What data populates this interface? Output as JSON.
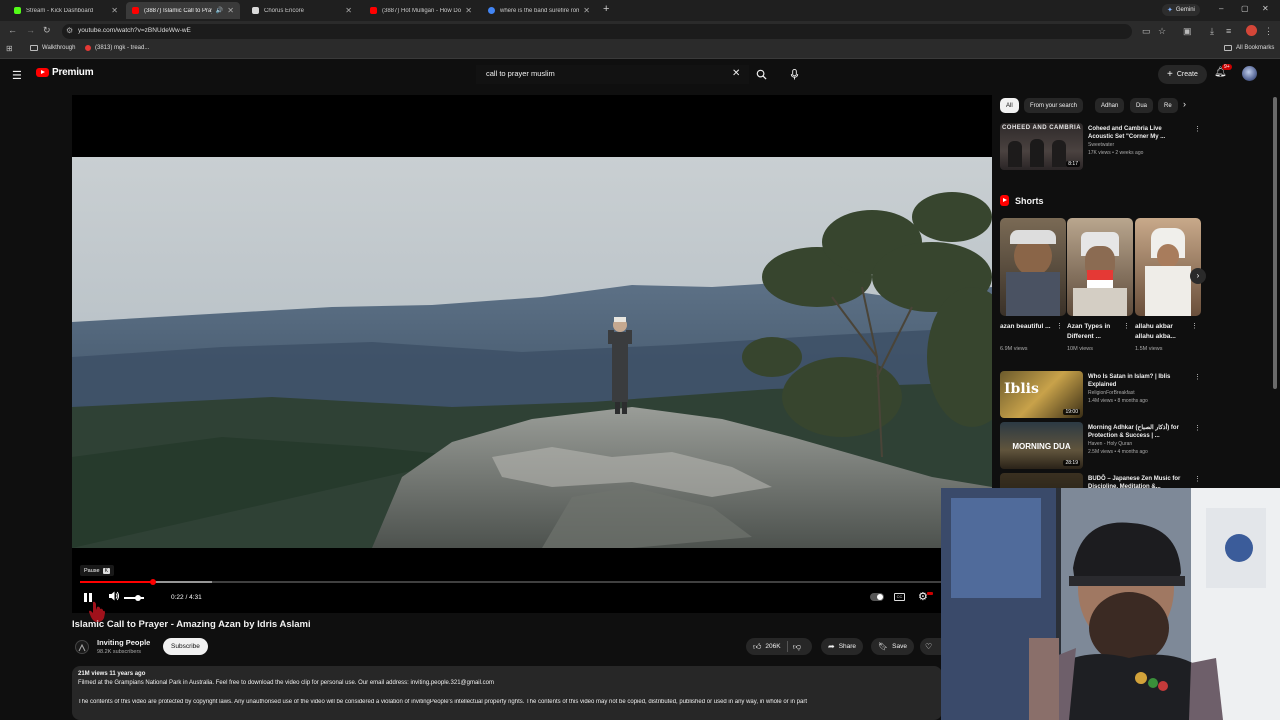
{
  "browser": {
    "tabs": [
      {
        "title": "Stream - Kick Dashboard",
        "color": "#53fc18"
      },
      {
        "title": "(3887) Islamic Call to Prayer",
        "color": "#ff0000"
      },
      {
        "title": "Chorus Encore",
        "color": "#d9d9d9"
      },
      {
        "title": "(3887) Hot Mulligan - How Do",
        "color": "#ff0000"
      },
      {
        "title": "where is the band surefire rom",
        "color": "#4285f4"
      }
    ],
    "gemini_label": "Gemini",
    "url": "youtube.com/watch?v=zBNUdeWw-wE",
    "bookmarks": [
      {
        "label": "Walkthrough"
      },
      {
        "label": "(3813) mgk - tread..."
      }
    ],
    "all_bookmarks": "All Bookmarks"
  },
  "header": {
    "logo_text": "Premium",
    "search_query": "call to prayer muslim",
    "create_label": "Create",
    "notif_badge": "9+"
  },
  "player": {
    "tooltip": "Pause",
    "tooltip_key": "K",
    "time_display": "0:22 / 4:31",
    "progress_played_fraction": 0.081,
    "progress_loaded_fraction": 0.146,
    "volume_fraction": 0.7
  },
  "video": {
    "title": "Islamic Call to Prayer - Amazing Azan by Idris Aslami",
    "channel": "Inviting People",
    "subscribers": "98.2K subscribers",
    "subscribe_label": "Subscribe",
    "likes": "206K",
    "share_label": "Share",
    "save_label": "Save",
    "views_date": "21M views  11 years ago",
    "desc_line1": "Filmed at the Grampians National Park in Australia. Feel free to download the video clip for personal use. Our email address: inviting.people.321@gmail.com",
    "desc_line2": "The contents of this video are protected by copyright laws.  Any unauthorised use of the video will be considered a violation of invitingPeople's intellectual property rights. The contents of this video may not be copied, distributed, published or used in any way, in whole or in part"
  },
  "sidebar": {
    "chips": [
      "All",
      "From your search",
      "Adhan",
      "Dua",
      "Re"
    ],
    "rec_top": {
      "title": "Coheed and Cambria Live Acoustic Set \"Corner My ...",
      "channel": "Sweetwater",
      "meta": "17K views • 2 weeks ago",
      "duration": "8:17",
      "thumb_text": "COHEED AND CAMBRIA"
    },
    "shorts_label": "Shorts",
    "shorts": [
      {
        "title": "azan beautiful ...",
        "views": "6.9M views"
      },
      {
        "title": "Azan Types in Different ...",
        "views": "10M views"
      },
      {
        "title": "allahu akbar allahu akba...",
        "views": "1.5M views"
      }
    ],
    "recs": [
      {
        "title": "Who Is Satan in Islam? | Iblis Explained",
        "channel": "ReligionForBreakfast",
        "meta": "1.4M views • 8 months ago",
        "duration": "19:00",
        "thumb_text": "Iblis"
      },
      {
        "title": "Morning Adhkar (أذكار الصباح) for Protection & Success | ...",
        "channel": "Haven - Holy Quran",
        "meta": "2.5M views • 4 months ago",
        "duration": "28:19",
        "thumb_text": "MORNING DUA"
      },
      {
        "title": "BUDŌ – Japanese Zen Music for Discipline, Meditation &...",
        "channel": "",
        "meta": "",
        "duration": "",
        "thumb_text": ""
      }
    ]
  }
}
